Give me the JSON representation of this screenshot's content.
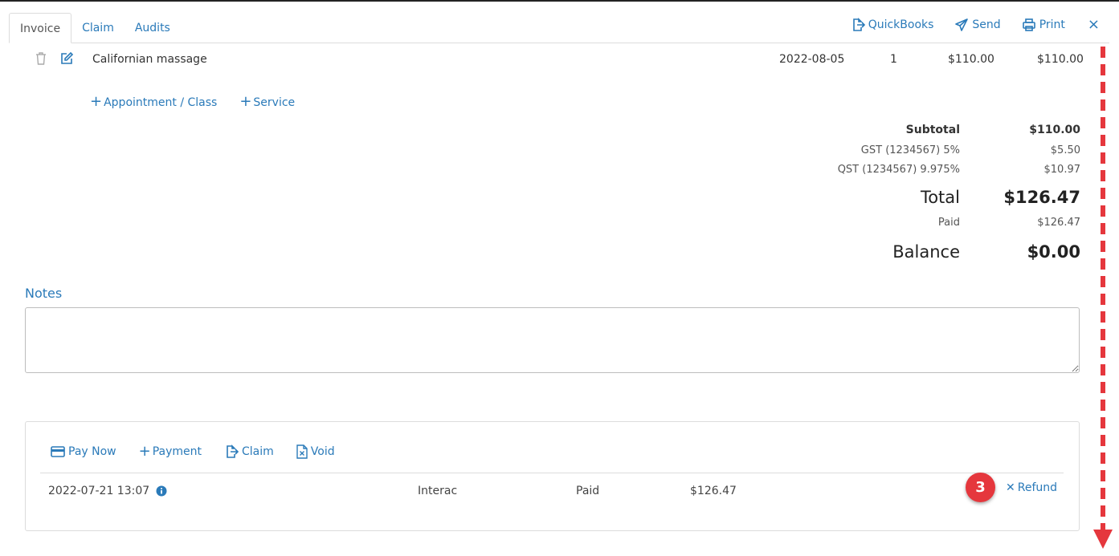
{
  "tabs": [
    {
      "label": "Invoice",
      "active": true
    },
    {
      "label": "Claim",
      "active": false
    },
    {
      "label": "Audits",
      "active": false
    }
  ],
  "toolbar": {
    "quickbooks": "QuickBooks",
    "send": "Send",
    "print": "Print",
    "close": "×"
  },
  "line_item": {
    "description": "Californian massage",
    "date": "2022-08-05",
    "quantity": "1",
    "unit_price": "$110.00",
    "amount": "$110.00"
  },
  "add_links": {
    "appointment": "Appointment / Class",
    "service": "Service"
  },
  "totals": {
    "subtotal_label": "Subtotal",
    "subtotal_value": "$110.00",
    "gst_label": "GST (1234567) 5%",
    "gst_value": "$5.50",
    "qst_label": "QST (1234567) 9.975%",
    "qst_value": "$10.97",
    "total_label": "Total",
    "total_value": "$126.47",
    "paid_label": "Paid",
    "paid_value": "$126.47",
    "balance_label": "Balance",
    "balance_value": "$0.00"
  },
  "notes": {
    "label": "Notes",
    "value": ""
  },
  "payment_actions": {
    "pay_now": "Pay Now",
    "payment": "Payment",
    "claim": "Claim",
    "void": "Void"
  },
  "payments": [
    {
      "datetime": "2022-07-21 13:07",
      "method": "Interac",
      "status": "Paid",
      "amount": "$126.47",
      "refund_label": "Refund"
    }
  ],
  "annotation": {
    "badge_number": "3"
  },
  "colors": {
    "link": "#2a7ab9",
    "annotation_red": "#e5373d"
  }
}
